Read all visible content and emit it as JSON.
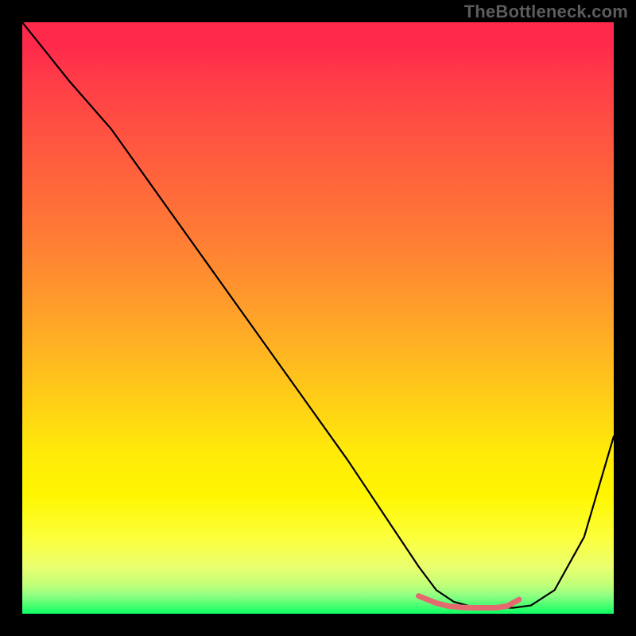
{
  "watermark": "TheBottleneck.com",
  "chart_data": {
    "type": "line",
    "title": "",
    "xlabel": "",
    "ylabel": "",
    "xlim": [
      0,
      100
    ],
    "ylim": [
      0,
      100
    ],
    "grid": false,
    "legend": false,
    "background_gradient": {
      "top": "#ff2a4b",
      "mid": "#ffe80a",
      "bottom": "#0cff63"
    },
    "series": [
      {
        "name": "bottleneck-curve",
        "color": "#000000",
        "x": [
          0,
          4,
          8,
          15,
          25,
          35,
          45,
          55,
          63,
          67,
          70,
          73,
          76,
          80,
          83,
          86,
          90,
          95,
          100
        ],
        "y": [
          100,
          95,
          90,
          82,
          68,
          54,
          40,
          26,
          14,
          8,
          4,
          2,
          1.2,
          1,
          1,
          1.4,
          4,
          13,
          30
        ]
      },
      {
        "name": "flat-min-marker",
        "color": "#e46a6f",
        "x": [
          67,
          70,
          72,
          74,
          76,
          78,
          80,
          82,
          84
        ],
        "y": [
          3.0,
          1.8,
          1.3,
          1.1,
          1.0,
          1.0,
          1.0,
          1.3,
          2.4
        ]
      }
    ]
  }
}
